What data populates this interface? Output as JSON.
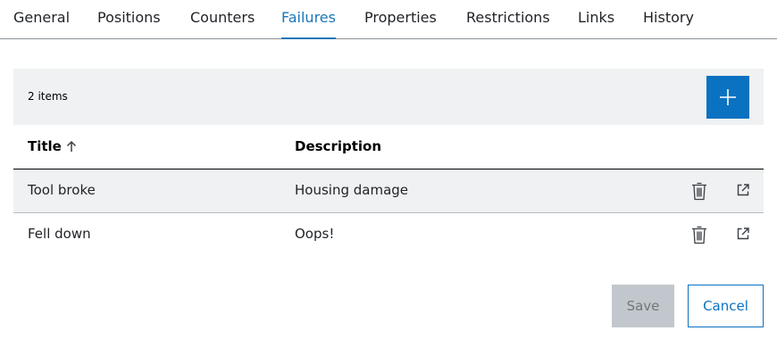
{
  "tabs": [
    {
      "label": "General"
    },
    {
      "label": "Positions"
    },
    {
      "label": "Counters"
    },
    {
      "label": "Failures",
      "active": true
    },
    {
      "label": "Properties"
    },
    {
      "label": "Restrictions"
    },
    {
      "label": "Links"
    },
    {
      "label": "History"
    }
  ],
  "toolbar": {
    "item_count": "2 items",
    "add_icon": "plus-icon"
  },
  "table": {
    "columns": [
      {
        "label": "Title",
        "sort": "ascending"
      },
      {
        "label": "Description"
      }
    ],
    "rows": [
      {
        "title": "Tool broke",
        "description": "Housing damage"
      },
      {
        "title": "Fell down",
        "description": "Oops!"
      }
    ],
    "row_actions": [
      "trash-icon",
      "external-link-icon"
    ]
  },
  "footer": {
    "save_label": "Save",
    "cancel_label": "Cancel"
  },
  "colors": {
    "accent": "#1a77b8",
    "primary_button": "#0a72c0",
    "toolbar_bg": "#eff1f2",
    "disabled_button": "#c1c7cc"
  }
}
